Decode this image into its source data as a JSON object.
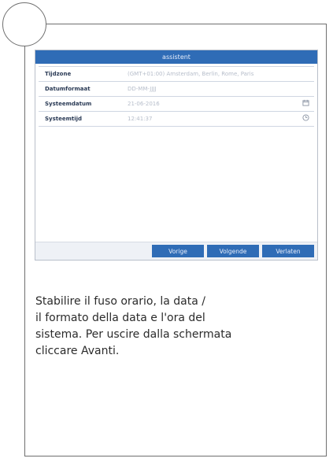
{
  "window": {
    "title": "assistent",
    "fields": [
      {
        "label": "Tijdzone",
        "value": "(GMT+01:00) Amsterdam, Berlin, Rome, Paris",
        "icon": ""
      },
      {
        "label": "Datumformaat",
        "value": "DD-MM-JJJJ",
        "icon": ""
      },
      {
        "label": "Systeemdatum",
        "value": "21-06-2016",
        "icon": "calendar-icon"
      },
      {
        "label": "Systeemtijd",
        "value": "12:41:37",
        "icon": "clock-icon"
      }
    ],
    "buttons": {
      "previous": "Vorige",
      "next": "Volgende",
      "exit": "Verlaten"
    }
  },
  "caption": {
    "lines": [
      "Stabilire il fuso orario, la data /",
      "il formato della data e l'ora del",
      "sistema. Per uscire dalla schermata",
      "cliccare Avanti."
    ]
  },
  "colors": {
    "accent": "#2f6cb6",
    "border": "#6f6f6f"
  }
}
